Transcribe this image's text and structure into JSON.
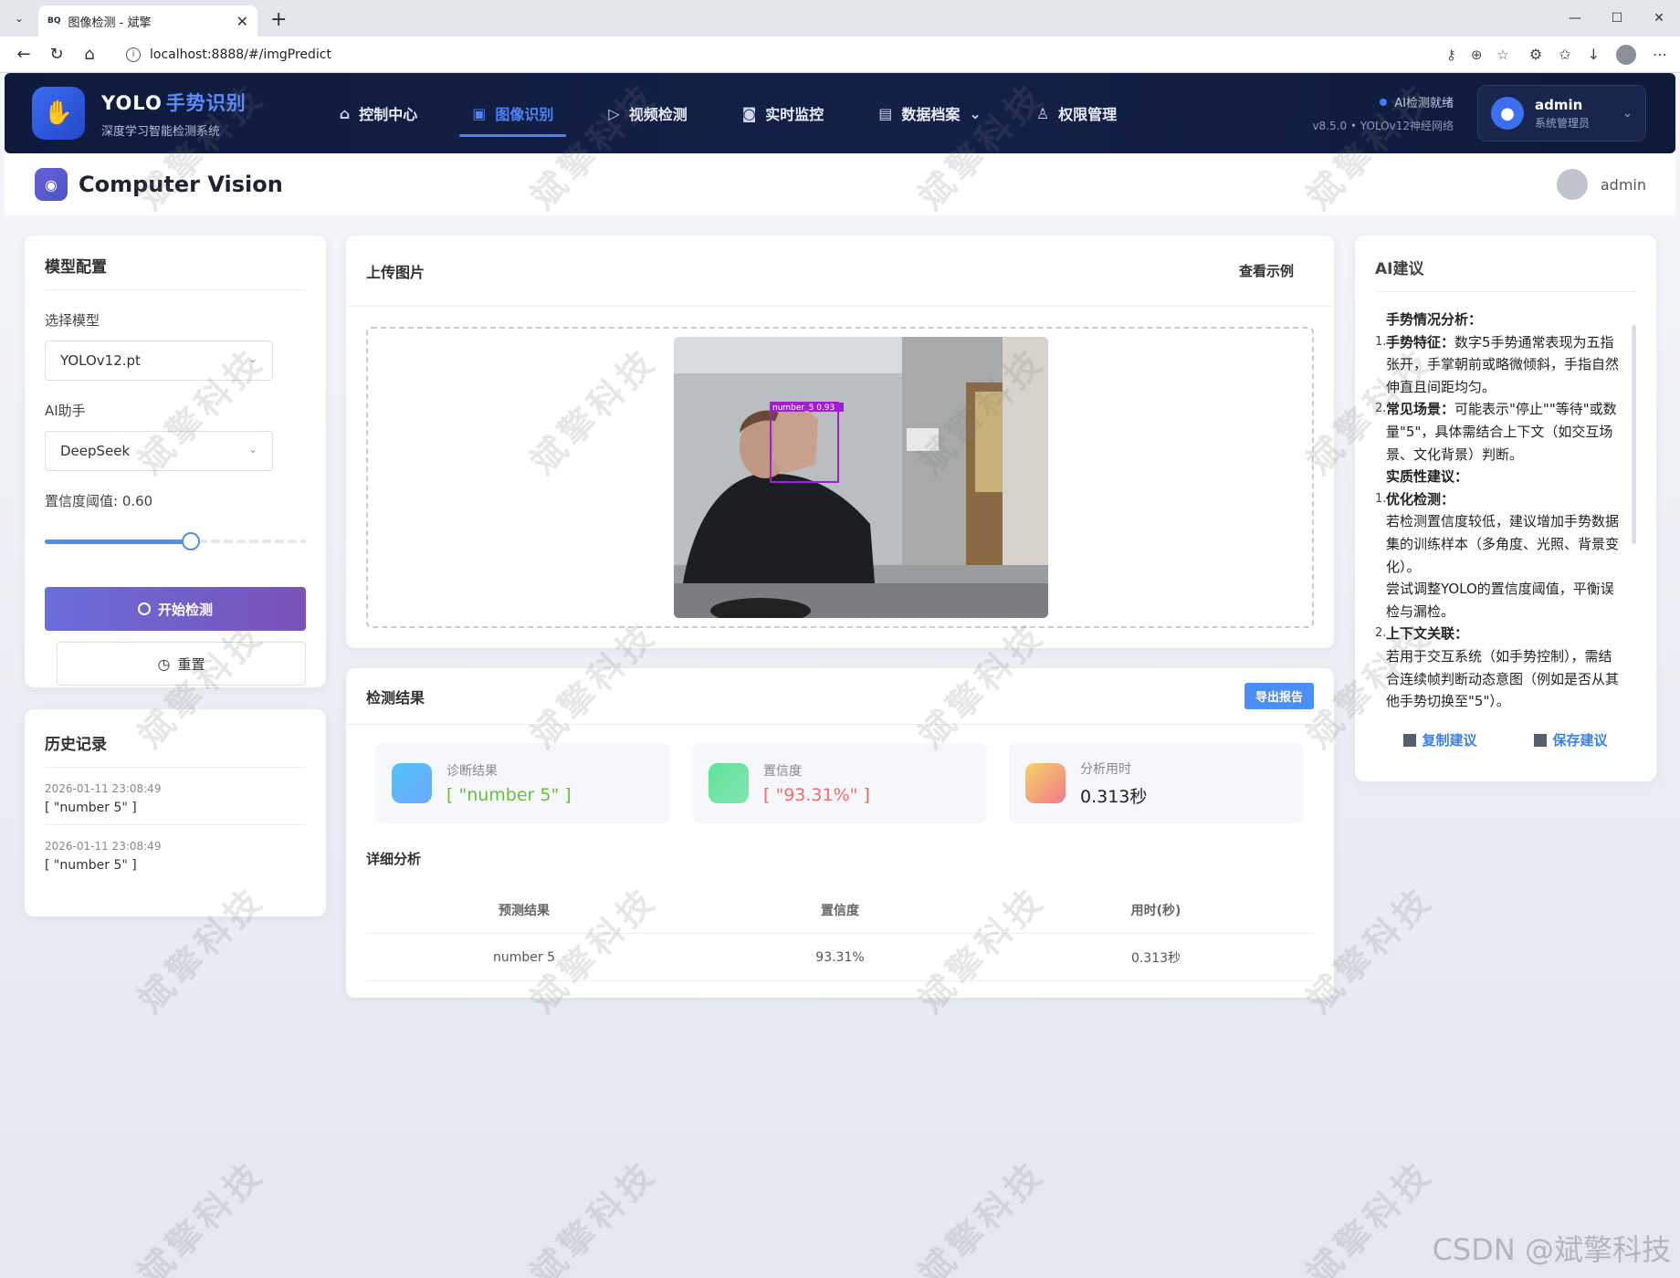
{
  "browser": {
    "tab_title": "图像检测 - 斌擎",
    "tab_favicon": "BQ",
    "url": "localhost:8888/#/imgPredict"
  },
  "header": {
    "brand_prefix": "YOLO",
    "brand_highlight": "手势识别",
    "brand_sub": "深度学习智能检测系统",
    "menu": [
      {
        "icon": "home-icon",
        "label": "控制中心",
        "active": false
      },
      {
        "icon": "image-icon",
        "label": "图像识别",
        "active": true
      },
      {
        "icon": "play-icon",
        "label": "视频检测",
        "active": false
      },
      {
        "icon": "camera-icon",
        "label": "实时监控",
        "active": false
      },
      {
        "icon": "document-icon",
        "label": "数据档案",
        "active": false
      },
      {
        "icon": "user-icon",
        "label": "权限管理",
        "active": false
      }
    ],
    "status_text": "AI检测就绪",
    "version_text": "v8.5.0 • YOLOv12神经网络",
    "user_name": "admin",
    "user_role": "系统管理员"
  },
  "subheader": {
    "title": "Computer Vision",
    "user": "admin"
  },
  "config": {
    "title": "模型配置",
    "model_label": "选择模型",
    "model_value": "YOLOv12.pt",
    "ai_label": "AI助手",
    "ai_value": "DeepSeek",
    "threshold_label": "置信度阈值: 0.60",
    "threshold": 0.6,
    "start_label": "开始检测",
    "reset_label": "重置"
  },
  "history": {
    "title": "历史记录",
    "items": [
      {
        "time": "2026-01-11 23:08:49",
        "result": "[ \"number 5\" ]"
      },
      {
        "time": "2026-01-11 23:08:49",
        "result": "[ \"number 5\" ]"
      }
    ]
  },
  "upload": {
    "title": "上传图片",
    "example_label": "查看示例",
    "detection_label": "number_5 0.93"
  },
  "results": {
    "title": "检测结果",
    "export_label": "导出报告",
    "stats": [
      {
        "label": "诊断结果",
        "value": "[ \"number 5\" ]",
        "color": "#67c23a"
      },
      {
        "label": "置信度",
        "value": "[ \"93.31%\" ]",
        "color": "#f56c6c"
      },
      {
        "label": "分析用时",
        "value": "0.313秒",
        "color": "#222222"
      }
    ],
    "detail_title": "详细分析",
    "columns": [
      "预测结果",
      "置信度",
      "用时(秒)"
    ],
    "rows": [
      [
        "number 5",
        "93.31%",
        "0.313秒"
      ]
    ]
  },
  "ai": {
    "title": "AI建议",
    "lines": [
      {
        "num": "",
        "bold": "手势情况分析：",
        "text": ""
      },
      {
        "num": "1.",
        "bold": "手势特征：",
        "text": "数字5手势通常表现为五指张开，手掌朝前或略微倾斜，手指自然伸直且间距均匀。"
      },
      {
        "num": "2.",
        "bold": "常见场景：",
        "text": "可能表示\"停止\"\"等待\"或数量\"5\"，具体需结合上下文（如交互场景、文化背景）判断。"
      },
      {
        "num": "",
        "bold": "实质性建议：",
        "text": ""
      },
      {
        "num": "1.",
        "bold": "优化检测：",
        "text": ""
      },
      {
        "num": "",
        "bold": "",
        "text": "若检测置信度较低，建议增加手势数据集的训练样本（多角度、光照、背景变化）。"
      },
      {
        "num": "",
        "bold": "",
        "text": "尝试调整YOLO的置信度阈值，平衡误检与漏检。"
      },
      {
        "num": "2.",
        "bold": "上下文关联：",
        "text": ""
      },
      {
        "num": "",
        "bold": "",
        "text": "若用于交互系统（如手势控制），需结合连续帧判断动态意图（例如是否从其他手势切换至\"5\"）。"
      }
    ],
    "copy_label": "复制建议",
    "save_label": "保存建议"
  },
  "watermark": "斌擎科技",
  "footer_watermark": "CSDN @斌擎科技"
}
